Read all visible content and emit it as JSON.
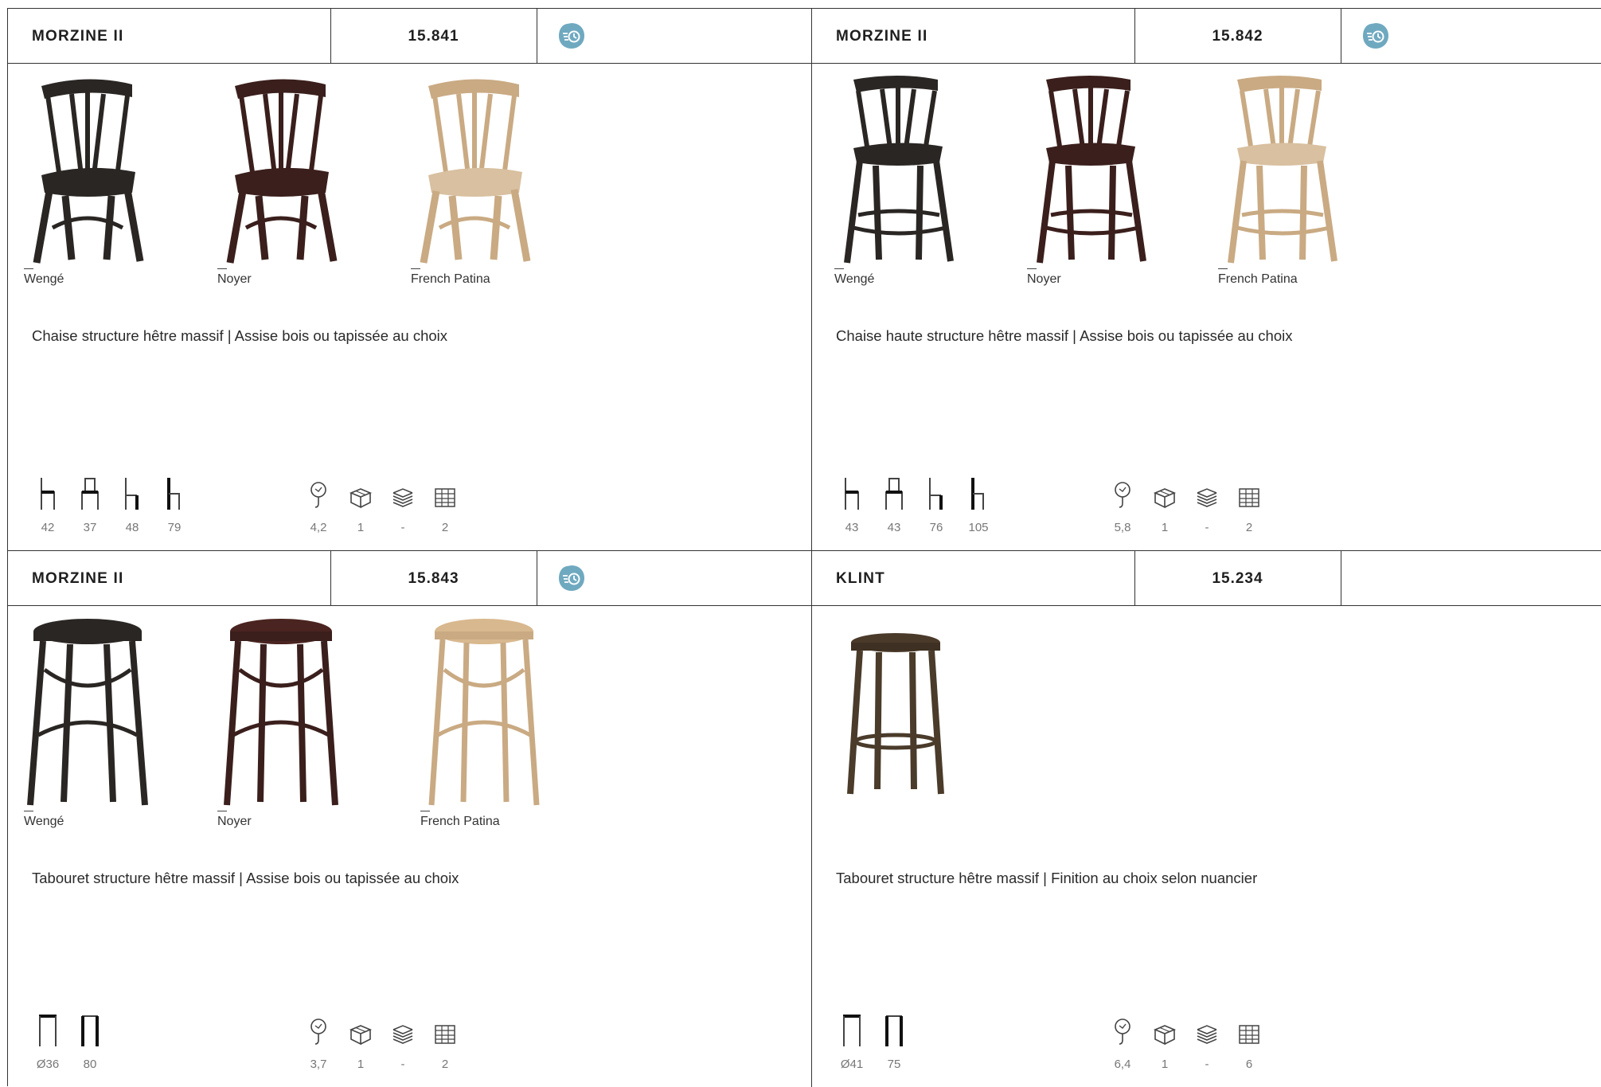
{
  "colors": {
    "accent": "#6fa9c0",
    "border": "#333333"
  },
  "cards": [
    {
      "name": "MORZINE II",
      "ref": "15.841",
      "badge": "fast-delivery-icon",
      "variants": [
        "Wengé",
        "Noyer",
        "French Patina"
      ],
      "description": "Chaise structure hêtre massif | Assise bois ou tapissée au choix",
      "dims": [
        "42",
        "37",
        "48",
        "79"
      ],
      "specs": [
        "4,2",
        "1",
        "-",
        "2"
      ]
    },
    {
      "name": "MORZINE II",
      "ref": "15.842",
      "badge": "fast-delivery-icon",
      "variants": [
        "Wengé",
        "Noyer",
        "French Patina"
      ],
      "description": "Chaise haute structure hêtre massif | Assise bois ou tapissée au choix",
      "dims": [
        "43",
        "43",
        "76",
        "105"
      ],
      "specs": [
        "5,8",
        "1",
        "-",
        "2"
      ]
    },
    {
      "name": "MORZINE II",
      "ref": "15.843",
      "badge": "fast-delivery-icon",
      "variants": [
        "Wengé",
        "Noyer",
        "French Patina"
      ],
      "description": "Tabouret structure hêtre massif | Assise bois ou tapissée au choix",
      "dims": [
        "Ø36",
        "80"
      ],
      "specs": [
        "3,7",
        "1",
        "-",
        "2"
      ]
    },
    {
      "name": "KLINT",
      "ref": "15.234",
      "variants": [],
      "description": "Tabouret structure hêtre massif | Finition au choix selon nuancier",
      "dims": [
        "Ø41",
        "75"
      ],
      "specs": [
        "6,4",
        "1",
        "-",
        "6"
      ]
    }
  ],
  "icons": {
    "dims_chair": [
      "seat-height-icon",
      "depth-icon",
      "width-icon",
      "total-height-icon"
    ],
    "dims_stool": [
      "diameter-icon",
      "height-icon"
    ],
    "specs": [
      "weight-icon",
      "box-icon",
      "stack-icon",
      "pallet-icon"
    ]
  }
}
